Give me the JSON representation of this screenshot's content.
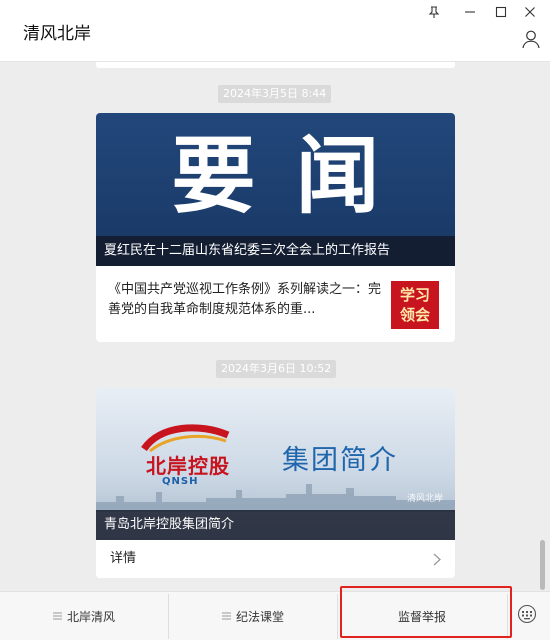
{
  "window": {
    "title": "清风北岸",
    "icons": [
      "pin-icon",
      "minimize-icon",
      "maximize-icon",
      "close-icon",
      "user-icon"
    ]
  },
  "messages": [
    {
      "timestamp": "2024年3月5日 8:44",
      "cover_title": "要闻",
      "cover_caption": "夏红民在十二届山东省纪委三次全会上的工作报告",
      "sub_item_text": "《中国共产党巡视工作条例》系列解读之一：完善党的自我革命制度规范体系的重...",
      "sub_item_thumb": [
        "学习",
        "领会"
      ]
    },
    {
      "timestamp": "2024年3月6日 10:52",
      "logo_text": "北岸控股",
      "logo_sub": "QNSH",
      "cover_title": "集团简介",
      "cover_watermark": "清风北岸",
      "cover_caption": "青岛北岸控股集团简介",
      "detail_label": "详情"
    }
  ],
  "bottom_menu": {
    "tabs": [
      {
        "label": "北岸清风",
        "has_menu_icon": true
      },
      {
        "label": "纪法课堂",
        "has_menu_icon": true
      },
      {
        "label": "监督举报",
        "has_menu_icon": false,
        "highlighted": true
      }
    ],
    "keyboard_icon": "keyboard-icon"
  },
  "colors": {
    "highlight_border": "#e0231f",
    "cover_blue": "#1c3e6e",
    "brand_red": "#c8141e",
    "brand_blue": "#1f66ad"
  }
}
